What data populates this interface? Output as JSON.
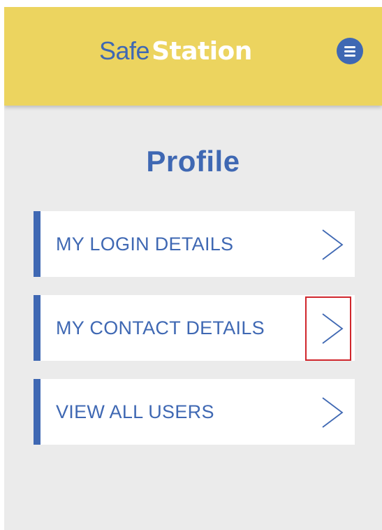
{
  "header": {
    "logo_part1": "Safe",
    "logo_part2": "Station",
    "menu_icon": "hamburger-menu-icon"
  },
  "page": {
    "title": "Profile"
  },
  "menu": {
    "items": [
      {
        "label": "MY LOGIN DETAILS",
        "icon": "chevron-right-icon"
      },
      {
        "label": "MY CONTACT DETAILS",
        "icon": "chevron-right-icon"
      },
      {
        "label": "VIEW ALL USERS",
        "icon": "chevron-right-icon"
      }
    ]
  },
  "colors": {
    "header_bg": "#ecd45f",
    "brand_blue": "#3f68b3",
    "page_bg": "#ebebeb",
    "item_bg": "#ffffff",
    "highlight": "#d0262c"
  }
}
